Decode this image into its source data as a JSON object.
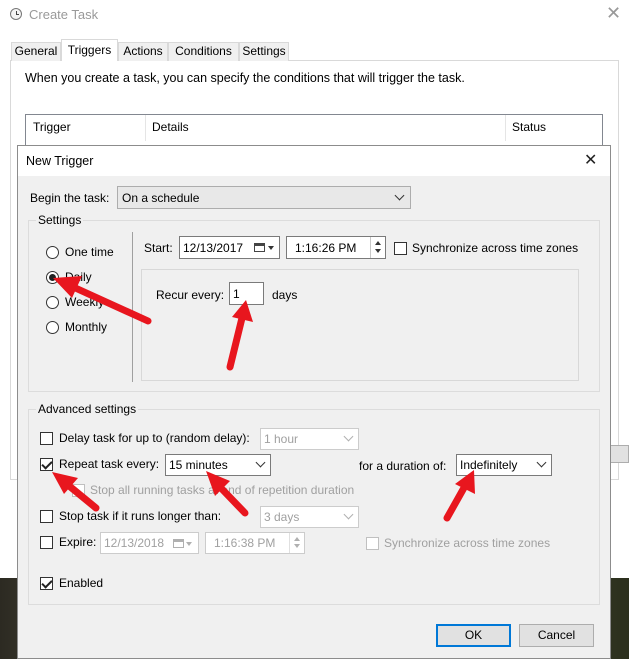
{
  "parent_window": {
    "title": "Create Task",
    "tabs": [
      {
        "label": "General"
      },
      {
        "label": "Triggers"
      },
      {
        "label": "Actions"
      },
      {
        "label": "Conditions"
      },
      {
        "label": "Settings"
      }
    ],
    "active_tab": "Triggers",
    "description": "When you create a task, you can specify the conditions that will trigger the task.",
    "columns": [
      "Trigger",
      "Details",
      "Status"
    ]
  },
  "dialog": {
    "title": "New Trigger",
    "begin_label": "Begin the task:",
    "begin_value": "On a schedule",
    "settings": {
      "title": "Settings",
      "options": [
        {
          "label": "One time",
          "selected": false
        },
        {
          "label": "Daily",
          "selected": true
        },
        {
          "label": "Weekly",
          "selected": false
        },
        {
          "label": "Monthly",
          "selected": false
        }
      ],
      "start_label": "Start:",
      "start_date": "12/13/2017",
      "start_time": "1:16:26 PM",
      "sync_label": "Synchronize across time zones",
      "sync_checked": false,
      "recur_label": "Recur every:",
      "recur_value": "1",
      "recur_unit": "days"
    },
    "advanced": {
      "title": "Advanced settings",
      "delay": {
        "label": "Delay task for up to (random delay):",
        "checked": false,
        "value": "1 hour"
      },
      "repeat": {
        "label": "Repeat task every:",
        "checked": true,
        "value": "15 minutes",
        "duration_label": "for a duration of:",
        "duration_value": "Indefinitely"
      },
      "stop_all": {
        "label": "Stop all running tasks at end of repetition duration",
        "checked": false
      },
      "stop_long": {
        "label": "Stop task if it runs longer than:",
        "checked": false,
        "value": "3 days"
      },
      "expire": {
        "label": "Expire:",
        "checked": false,
        "date": "12/13/2018",
        "time": "1:16:38 PM",
        "sync_label": "Synchronize across time zones"
      },
      "enabled": {
        "label": "Enabled",
        "checked": true
      }
    },
    "ok_label": "OK",
    "cancel_label": "Cancel"
  },
  "colors": {
    "annotation_arrow": "#e8161e",
    "focus_blue": "#0078d7"
  }
}
